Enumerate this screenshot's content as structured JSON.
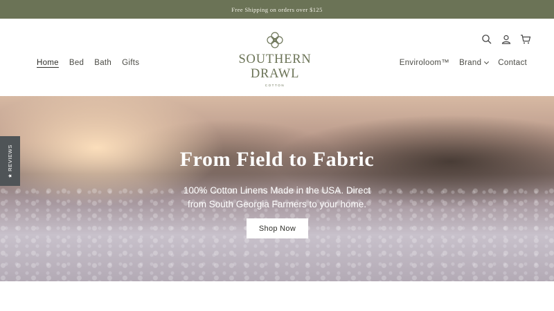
{
  "announcement": "Free Shipping on orders over $125",
  "nav_left": [
    {
      "label": "Home",
      "active": true
    },
    {
      "label": "Bed"
    },
    {
      "label": "Bath"
    },
    {
      "label": "Gifts"
    }
  ],
  "nav_right": [
    {
      "label": "Enviroloom™"
    },
    {
      "label": "Brand"
    },
    {
      "label": "Contact"
    }
  ],
  "logo": {
    "line1": "SOUTHERN",
    "line2": "DRAWL",
    "sub": "COTTON"
  },
  "icons": [
    "search-icon",
    "account-icon",
    "cart-icon"
  ],
  "hero": {
    "title": "From Field to Fabric",
    "subtitle": "100% Cotton Linens Made in the USA. Direct from South Georgia Farmers to your home.",
    "cta": "Shop Now"
  },
  "reviews_tab": "★ REVIEWS",
  "colors": {
    "brand": "#6b7356",
    "announcement_bg": "#6b7356",
    "reviews_tab_bg": "#4f5457"
  }
}
